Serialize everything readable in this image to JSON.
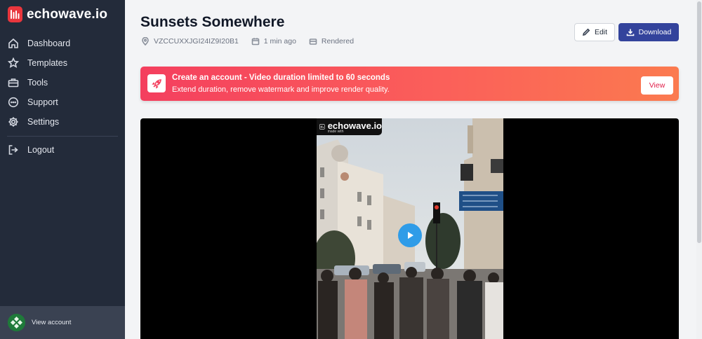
{
  "brand": {
    "name": "echowave.io",
    "accent": "#e9363d"
  },
  "sidebar": {
    "items": [
      {
        "label": "Dashboard",
        "icon": "home-icon"
      },
      {
        "label": "Templates",
        "icon": "star-icon"
      },
      {
        "label": "Tools",
        "icon": "toolbox-icon"
      },
      {
        "label": "Support",
        "icon": "chat-icon"
      },
      {
        "label": "Settings",
        "icon": "gear-icon"
      }
    ],
    "logout_label": "Logout",
    "view_account_label": "View account"
  },
  "project": {
    "title": "Sunsets Somewhere",
    "id": "VZCCUXXJGI24IZ9I20B1",
    "time": "1 min ago",
    "status": "Rendered"
  },
  "toolbar": {
    "edit_label": "Edit",
    "download_label": "Download",
    "download_color": "#33439c"
  },
  "banner": {
    "title": "Create an account - Video duration limited to 60 seconds",
    "subtitle": "Extend duration, remove watermark and improve render quality.",
    "button_label": "View"
  },
  "player": {
    "watermark": "echowave.io",
    "watermark_sub": "made with"
  }
}
